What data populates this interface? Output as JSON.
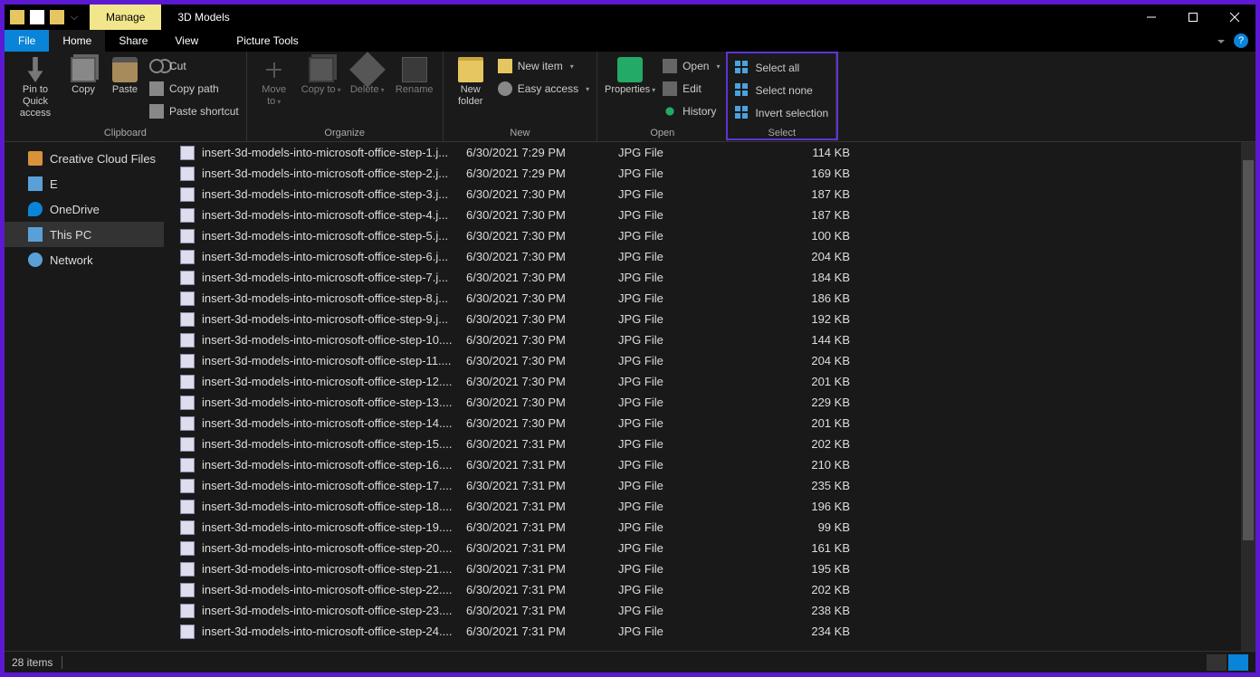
{
  "window": {
    "contextual_tab": "Manage",
    "title": "3D Models",
    "picture_tools": "Picture Tools"
  },
  "tabs": {
    "file": "File",
    "home": "Home",
    "share": "Share",
    "view": "View"
  },
  "ribbon": {
    "clipboard": {
      "label": "Clipboard",
      "pin": "Pin to Quick access",
      "copy": "Copy",
      "paste": "Paste",
      "cut": "Cut",
      "copy_path": "Copy path",
      "paste_shortcut": "Paste shortcut"
    },
    "organize": {
      "label": "Organize",
      "move_to": "Move to",
      "copy_to": "Copy to",
      "delete": "Delete",
      "rename": "Rename"
    },
    "new": {
      "label": "New",
      "new_folder": "New folder",
      "new_item": "New item",
      "easy_access": "Easy access"
    },
    "open": {
      "label": "Open",
      "properties": "Properties",
      "open": "Open",
      "edit": "Edit",
      "history": "History"
    },
    "select": {
      "label": "Select",
      "select_all": "Select all",
      "select_none": "Select none",
      "invert": "Invert selection"
    }
  },
  "nav": {
    "creative_cloud": "Creative Cloud Files",
    "drive_e": "E",
    "onedrive": "OneDrive",
    "this_pc": "This PC",
    "network": "Network"
  },
  "files": [
    {
      "name": "insert-3d-models-into-microsoft-office-step-1.j...",
      "date": "6/30/2021 7:29 PM",
      "type": "JPG File",
      "size": "114 KB"
    },
    {
      "name": "insert-3d-models-into-microsoft-office-step-2.j...",
      "date": "6/30/2021 7:29 PM",
      "type": "JPG File",
      "size": "169 KB"
    },
    {
      "name": "insert-3d-models-into-microsoft-office-step-3.j...",
      "date": "6/30/2021 7:30 PM",
      "type": "JPG File",
      "size": "187 KB"
    },
    {
      "name": "insert-3d-models-into-microsoft-office-step-4.j...",
      "date": "6/30/2021 7:30 PM",
      "type": "JPG File",
      "size": "187 KB"
    },
    {
      "name": "insert-3d-models-into-microsoft-office-step-5.j...",
      "date": "6/30/2021 7:30 PM",
      "type": "JPG File",
      "size": "100 KB"
    },
    {
      "name": "insert-3d-models-into-microsoft-office-step-6.j...",
      "date": "6/30/2021 7:30 PM",
      "type": "JPG File",
      "size": "204 KB"
    },
    {
      "name": "insert-3d-models-into-microsoft-office-step-7.j...",
      "date": "6/30/2021 7:30 PM",
      "type": "JPG File",
      "size": "184 KB"
    },
    {
      "name": "insert-3d-models-into-microsoft-office-step-8.j...",
      "date": "6/30/2021 7:30 PM",
      "type": "JPG File",
      "size": "186 KB"
    },
    {
      "name": "insert-3d-models-into-microsoft-office-step-9.j...",
      "date": "6/30/2021 7:30 PM",
      "type": "JPG File",
      "size": "192 KB"
    },
    {
      "name": "insert-3d-models-into-microsoft-office-step-10....",
      "date": "6/30/2021 7:30 PM",
      "type": "JPG File",
      "size": "144 KB"
    },
    {
      "name": "insert-3d-models-into-microsoft-office-step-11....",
      "date": "6/30/2021 7:30 PM",
      "type": "JPG File",
      "size": "204 KB"
    },
    {
      "name": "insert-3d-models-into-microsoft-office-step-12....",
      "date": "6/30/2021 7:30 PM",
      "type": "JPG File",
      "size": "201 KB"
    },
    {
      "name": "insert-3d-models-into-microsoft-office-step-13....",
      "date": "6/30/2021 7:30 PM",
      "type": "JPG File",
      "size": "229 KB"
    },
    {
      "name": "insert-3d-models-into-microsoft-office-step-14....",
      "date": "6/30/2021 7:30 PM",
      "type": "JPG File",
      "size": "201 KB"
    },
    {
      "name": "insert-3d-models-into-microsoft-office-step-15....",
      "date": "6/30/2021 7:31 PM",
      "type": "JPG File",
      "size": "202 KB"
    },
    {
      "name": "insert-3d-models-into-microsoft-office-step-16....",
      "date": "6/30/2021 7:31 PM",
      "type": "JPG File",
      "size": "210 KB"
    },
    {
      "name": "insert-3d-models-into-microsoft-office-step-17....",
      "date": "6/30/2021 7:31 PM",
      "type": "JPG File",
      "size": "235 KB"
    },
    {
      "name": "insert-3d-models-into-microsoft-office-step-18....",
      "date": "6/30/2021 7:31 PM",
      "type": "JPG File",
      "size": "196 KB"
    },
    {
      "name": "insert-3d-models-into-microsoft-office-step-19....",
      "date": "6/30/2021 7:31 PM",
      "type": "JPG File",
      "size": "99 KB"
    },
    {
      "name": "insert-3d-models-into-microsoft-office-step-20....",
      "date": "6/30/2021 7:31 PM",
      "type": "JPG File",
      "size": "161 KB"
    },
    {
      "name": "insert-3d-models-into-microsoft-office-step-21....",
      "date": "6/30/2021 7:31 PM",
      "type": "JPG File",
      "size": "195 KB"
    },
    {
      "name": "insert-3d-models-into-microsoft-office-step-22....",
      "date": "6/30/2021 7:31 PM",
      "type": "JPG File",
      "size": "202 KB"
    },
    {
      "name": "insert-3d-models-into-microsoft-office-step-23....",
      "date": "6/30/2021 7:31 PM",
      "type": "JPG File",
      "size": "238 KB"
    },
    {
      "name": "insert-3d-models-into-microsoft-office-step-24....",
      "date": "6/30/2021 7:31 PM",
      "type": "JPG File",
      "size": "234 KB"
    }
  ],
  "status": {
    "count": "28 items"
  }
}
